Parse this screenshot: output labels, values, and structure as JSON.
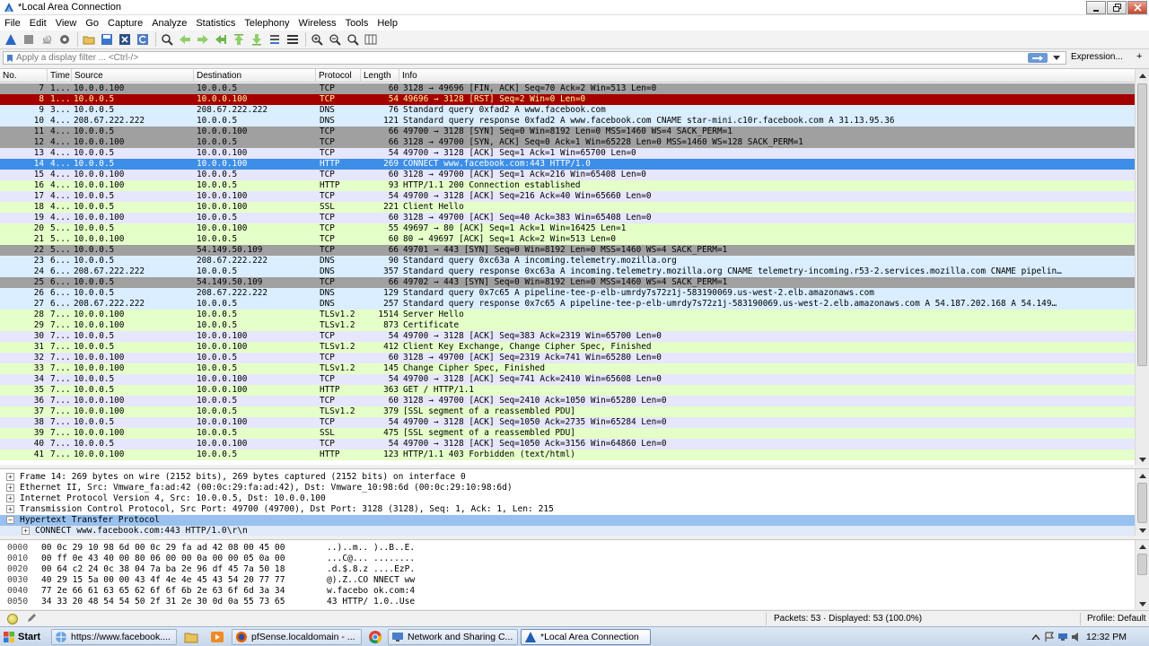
{
  "window": {
    "title": "*Local Area Connection"
  },
  "menu": [
    "File",
    "Edit",
    "View",
    "Go",
    "Capture",
    "Analyze",
    "Statistics",
    "Telephony",
    "Wireless",
    "Tools",
    "Help"
  ],
  "filter": {
    "placeholder": "Apply a display filter ... <Ctrl-/>",
    "expression_label": "Expression...",
    "plus_label": "+"
  },
  "packet_list": {
    "columns": [
      "No.",
      "Time",
      "Source",
      "Destination",
      "Protocol",
      "Length",
      "Info"
    ],
    "rows": [
      {
        "no": "7",
        "time": "1...",
        "src": "10.0.0.100",
        "dst": "10.0.0.5",
        "proto": "TCP",
        "len": "60",
        "info": "3128 → 49696 [FIN, ACK] Seq=70 Ack=2 Win=513 Len=0",
        "bg": "#a0a0a0",
        "fg": "#000000"
      },
      {
        "no": "8",
        "time": "1...",
        "src": "10.0.0.5",
        "dst": "10.0.0.100",
        "proto": "TCP",
        "len": "54",
        "info": "49696 → 3128 [RST] Seq=2 Win=0 Len=0",
        "bg": "#a40000",
        "fg": "#fffc9c"
      },
      {
        "no": "9",
        "time": "3...",
        "src": "10.0.0.5",
        "dst": "208.67.222.222",
        "proto": "DNS",
        "len": "76",
        "info": "Standard query 0xfad2 A www.facebook.com",
        "bg": "#daeeff",
        "fg": "#000000"
      },
      {
        "no": "10",
        "time": "4...",
        "src": "208.67.222.222",
        "dst": "10.0.0.5",
        "proto": "DNS",
        "len": "121",
        "info": "Standard query response 0xfad2 A www.facebook.com CNAME star-mini.c10r.facebook.com A 31.13.95.36",
        "bg": "#daeeff",
        "fg": "#000000"
      },
      {
        "no": "11",
        "time": "4...",
        "src": "10.0.0.5",
        "dst": "10.0.0.100",
        "proto": "TCP",
        "len": "66",
        "info": "49700 → 3128 [SYN] Seq=0 Win=8192 Len=0 MSS=1460 WS=4 SACK_PERM=1",
        "bg": "#a0a0a0",
        "fg": "#000000"
      },
      {
        "no": "12",
        "time": "4...",
        "src": "10.0.0.100",
        "dst": "10.0.0.5",
        "proto": "TCP",
        "len": "66",
        "info": "3128 → 49700 [SYN, ACK] Seq=0 Ack=1 Win=65228 Len=0 MSS=1460 WS=128 SACK_PERM=1",
        "bg": "#a0a0a0",
        "fg": "#000000"
      },
      {
        "no": "13",
        "time": "4...",
        "src": "10.0.0.5",
        "dst": "10.0.0.100",
        "proto": "TCP",
        "len": "54",
        "info": "49700 → 3128 [ACK] Seq=1 Ack=1 Win=65700 Len=0",
        "bg": "#e7e6ff",
        "fg": "#000000"
      },
      {
        "no": "14",
        "time": "4...",
        "src": "10.0.0.5",
        "dst": "10.0.0.100",
        "proto": "HTTP",
        "len": "269",
        "info": "CONNECT www.facebook.com:443 HTTP/1.0",
        "bg": "#3d8ee6",
        "fg": "#ffffff"
      },
      {
        "no": "15",
        "time": "4...",
        "src": "10.0.0.100",
        "dst": "10.0.0.5",
        "proto": "TCP",
        "len": "60",
        "info": "3128 → 49700 [ACK] Seq=1 Ack=216 Win=65408 Len=0",
        "bg": "#e7e6ff",
        "fg": "#000000"
      },
      {
        "no": "16",
        "time": "4...",
        "src": "10.0.0.100",
        "dst": "10.0.0.5",
        "proto": "HTTP",
        "len": "93",
        "info": "HTTP/1.1 200 Connection established",
        "bg": "#e4ffc7",
        "fg": "#000000"
      },
      {
        "no": "17",
        "time": "4...",
        "src": "10.0.0.5",
        "dst": "10.0.0.100",
        "proto": "TCP",
        "len": "54",
        "info": "49700 → 3128 [ACK] Seq=216 Ack=40 Win=65660 Len=0",
        "bg": "#e7e6ff",
        "fg": "#000000"
      },
      {
        "no": "18",
        "time": "4...",
        "src": "10.0.0.5",
        "dst": "10.0.0.100",
        "proto": "SSL",
        "len": "221",
        "info": "Client Hello",
        "bg": "#e4ffc7",
        "fg": "#000000"
      },
      {
        "no": "19",
        "time": "4...",
        "src": "10.0.0.100",
        "dst": "10.0.0.5",
        "proto": "TCP",
        "len": "60",
        "info": "3128 → 49700 [ACK] Seq=40 Ack=383 Win=65408 Len=0",
        "bg": "#e7e6ff",
        "fg": "#000000"
      },
      {
        "no": "20",
        "time": "5...",
        "src": "10.0.0.5",
        "dst": "10.0.0.100",
        "proto": "TCP",
        "len": "55",
        "info": "49697 → 80 [ACK] Seq=1 Ack=1 Win=16425 Len=1",
        "bg": "#e4ffc7",
        "fg": "#000000"
      },
      {
        "no": "21",
        "time": "5...",
        "src": "10.0.0.100",
        "dst": "10.0.0.5",
        "proto": "TCP",
        "len": "60",
        "info": "80 → 49697 [ACK] Seq=1 Ack=2 Win=513 Len=0",
        "bg": "#e4ffc7",
        "fg": "#000000"
      },
      {
        "no": "22",
        "time": "5...",
        "src": "10.0.0.5",
        "dst": "54.149.50.109",
        "proto": "TCP",
        "len": "66",
        "info": "49701 → 443 [SYN] Seq=0 Win=8192 Len=0 MSS=1460 WS=4 SACK_PERM=1",
        "bg": "#a0a0a0",
        "fg": "#000000"
      },
      {
        "no": "23",
        "time": "6...",
        "src": "10.0.0.5",
        "dst": "208.67.222.222",
        "proto": "DNS",
        "len": "90",
        "info": "Standard query 0xc63a A incoming.telemetry.mozilla.org",
        "bg": "#daeeff",
        "fg": "#000000"
      },
      {
        "no": "24",
        "time": "6...",
        "src": "208.67.222.222",
        "dst": "10.0.0.5",
        "proto": "DNS",
        "len": "357",
        "info": "Standard query response 0xc63a A incoming.telemetry.mozilla.org CNAME telemetry-incoming.r53-2.services.mozilla.com CNAME pipelin…",
        "bg": "#daeeff",
        "fg": "#000000"
      },
      {
        "no": "25",
        "time": "6...",
        "src": "10.0.0.5",
        "dst": "54.149.50.109",
        "proto": "TCP",
        "len": "66",
        "info": "49702 → 443 [SYN] Seq=0 Win=8192 Len=0 MSS=1460 WS=4 SACK_PERM=1",
        "bg": "#a0a0a0",
        "fg": "#000000"
      },
      {
        "no": "26",
        "time": "6...",
        "src": "10.0.0.5",
        "dst": "208.67.222.222",
        "proto": "DNS",
        "len": "129",
        "info": "Standard query 0x7c65 A pipeline-tee-p-elb-umrdy7s72z1j-583190069.us-west-2.elb.amazonaws.com",
        "bg": "#daeeff",
        "fg": "#000000"
      },
      {
        "no": "27",
        "time": "6...",
        "src": "208.67.222.222",
        "dst": "10.0.0.5",
        "proto": "DNS",
        "len": "257",
        "info": "Standard query response 0x7c65 A pipeline-tee-p-elb-umrdy7s72z1j-583190069.us-west-2.elb.amazonaws.com A 54.187.202.168 A 54.149…",
        "bg": "#daeeff",
        "fg": "#000000"
      },
      {
        "no": "28",
        "time": "7...",
        "src": "10.0.0.100",
        "dst": "10.0.0.5",
        "proto": "TLSv1.2",
        "len": "1514",
        "info": "Server Hello",
        "bg": "#e4ffc7",
        "fg": "#000000"
      },
      {
        "no": "29",
        "time": "7...",
        "src": "10.0.0.100",
        "dst": "10.0.0.5",
        "proto": "TLSv1.2",
        "len": "873",
        "info": "Certificate",
        "bg": "#e4ffc7",
        "fg": "#000000"
      },
      {
        "no": "30",
        "time": "7...",
        "src": "10.0.0.5",
        "dst": "10.0.0.100",
        "proto": "TCP",
        "len": "54",
        "info": "49700 → 3128 [ACK] Seq=383 Ack=2319 Win=65700 Len=0",
        "bg": "#e7e6ff",
        "fg": "#000000"
      },
      {
        "no": "31",
        "time": "7...",
        "src": "10.0.0.5",
        "dst": "10.0.0.100",
        "proto": "TLSv1.2",
        "len": "412",
        "info": "Client Key Exchange, Change Cipher Spec, Finished",
        "bg": "#e4ffc7",
        "fg": "#000000"
      },
      {
        "no": "32",
        "time": "7...",
        "src": "10.0.0.100",
        "dst": "10.0.0.5",
        "proto": "TCP",
        "len": "60",
        "info": "3128 → 49700 [ACK] Seq=2319 Ack=741 Win=65280 Len=0",
        "bg": "#e7e6ff",
        "fg": "#000000"
      },
      {
        "no": "33",
        "time": "7...",
        "src": "10.0.0.100",
        "dst": "10.0.0.5",
        "proto": "TLSv1.2",
        "len": "145",
        "info": "Change Cipher Spec, Finished",
        "bg": "#e4ffc7",
        "fg": "#000000"
      },
      {
        "no": "34",
        "time": "7...",
        "src": "10.0.0.5",
        "dst": "10.0.0.100",
        "proto": "TCP",
        "len": "54",
        "info": "49700 → 3128 [ACK] Seq=741 Ack=2410 Win=65608 Len=0",
        "bg": "#e7e6ff",
        "fg": "#000000"
      },
      {
        "no": "35",
        "time": "7...",
        "src": "10.0.0.5",
        "dst": "10.0.0.100",
        "proto": "HTTP",
        "len": "363",
        "info": "GET / HTTP/1.1",
        "bg": "#e4ffc7",
        "fg": "#000000"
      },
      {
        "no": "36",
        "time": "7...",
        "src": "10.0.0.100",
        "dst": "10.0.0.5",
        "proto": "TCP",
        "len": "60",
        "info": "3128 → 49700 [ACK] Seq=2410 Ack=1050 Win=65280 Len=0",
        "bg": "#e7e6ff",
        "fg": "#000000"
      },
      {
        "no": "37",
        "time": "7...",
        "src": "10.0.0.100",
        "dst": "10.0.0.5",
        "proto": "TLSv1.2",
        "len": "379",
        "info": "[SSL segment of a reassembled PDU]",
        "bg": "#e4ffc7",
        "fg": "#000000"
      },
      {
        "no": "38",
        "time": "7...",
        "src": "10.0.0.5",
        "dst": "10.0.0.100",
        "proto": "TCP",
        "len": "54",
        "info": "49700 → 3128 [ACK] Seq=1050 Ack=2735 Win=65284 Len=0",
        "bg": "#e7e6ff",
        "fg": "#000000"
      },
      {
        "no": "39",
        "time": "7...",
        "src": "10.0.0.100",
        "dst": "10.0.0.5",
        "proto": "SSL",
        "len": "475",
        "info": "[SSL segment of a reassembled PDU]",
        "bg": "#e4ffc7",
        "fg": "#000000"
      },
      {
        "no": "40",
        "time": "7...",
        "src": "10.0.0.5",
        "dst": "10.0.0.100",
        "proto": "TCP",
        "len": "54",
        "info": "49700 → 3128 [ACK] Seq=1050 Ack=3156 Win=64860 Len=0",
        "bg": "#e7e6ff",
        "fg": "#000000"
      },
      {
        "no": "41",
        "time": "7...",
        "src": "10.0.0.100",
        "dst": "10.0.0.5",
        "proto": "HTTP",
        "len": "123",
        "info": "HTTP/1.1 403 Forbidden  (text/html)",
        "bg": "#e4ffc7",
        "fg": "#000000"
      }
    ]
  },
  "details": [
    {
      "text": "Frame 14: 269 bytes on wire (2152 bits), 269 bytes captured (2152 bits) on interface 0",
      "expander": "+",
      "selected": false,
      "child": false
    },
    {
      "text": "Ethernet II, Src: Vmware_fa:ad:42 (00:0c:29:fa:ad:42), Dst: Vmware_10:98:6d (00:0c:29:10:98:6d)",
      "expander": "+",
      "selected": false,
      "child": false
    },
    {
      "text": "Internet Protocol Version 4, Src: 10.0.0.5, Dst: 10.0.0.100",
      "expander": "+",
      "selected": false,
      "child": false
    },
    {
      "text": "Transmission Control Protocol, Src Port: 49700 (49700), Dst Port: 3128 (3128), Seq: 1, Ack: 1, Len: 215",
      "expander": "+",
      "selected": false,
      "child": false
    },
    {
      "text": "Hypertext Transfer Protocol",
      "expander": "−",
      "selected": true,
      "child": false
    },
    {
      "text": "CONNECT www.facebook.com:443 HTTP/1.0\\r\\n",
      "expander": "+",
      "selected": false,
      "child": true
    }
  ],
  "bytes": [
    {
      "offset": "0000",
      "hex": "00 0c 29 10 98 6d 00 0c  29 fa ad 42 08 00 45 00",
      "ascii": "..)..m.. )..B..E."
    },
    {
      "offset": "0010",
      "hex": "00 ff 0e 43 40 00 80 06  00 00 0a 00 00 05 0a 00",
      "ascii": "...C@... ........"
    },
    {
      "offset": "0020",
      "hex": "00 64 c2 24 0c 38 04 7a  ba 2e 96 df 45 7a 50 18",
      "ascii": ".d.$.8.z ....EzP."
    },
    {
      "offset": "0030",
      "hex": "40 29 15 5a 00 00 43 4f  4e 4e 45 43 54 20 77 77",
      "ascii": "@).Z..CO NNECT ww"
    },
    {
      "offset": "0040",
      "hex": "77 2e 66 61 63 65 62 6f  6f 6b 2e 63 6f 6d 3a 34",
      "ascii": "w.facebo ok.com:4"
    },
    {
      "offset": "0050",
      "hex": "34 33 20 48 54 54 50 2f  31 2e 30 0d 0a 55 73 65",
      "ascii": "43 HTTP/ 1.0..Use"
    }
  ],
  "status": {
    "packets": "Packets: 53 · Displayed: 53 (100.0%)",
    "profile": "Profile: Default"
  },
  "taskbar": {
    "start_label": "Start",
    "tasks": [
      {
        "label": "https://www.facebook...."
      },
      {
        "label": "pfSense.localdomain - ..."
      },
      {
        "label": "Network and Sharing C..."
      },
      {
        "label": "*Local Area Connection"
      }
    ],
    "clock": "12:32 PM"
  },
  "colors": {
    "selected_row": "#3d8ee6",
    "rst_row": "#a40000",
    "tcp_bad_row": "#a0a0a0",
    "dns_row": "#daeeff",
    "tcp_row": "#e7e6ff",
    "http_row": "#e4ffc7"
  }
}
